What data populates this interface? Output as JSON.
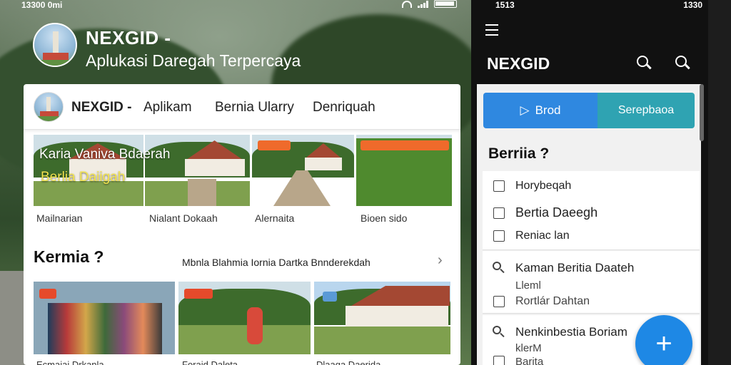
{
  "left_status": {
    "time": "13300 0mi"
  },
  "left_header": {
    "title": "NEXGID -",
    "subtitle": "Aplukasi Daregah Terpercaya"
  },
  "topnav": {
    "brand": "NEXGID -",
    "links": [
      "Aplikam",
      "Bernia Ularry",
      "Denriquah"
    ]
  },
  "featured": {
    "overlay_line1": "Karia Vaniva Bdaerah",
    "overlay_line2": "Berlia Daiigah",
    "captions": [
      "Mailnarian",
      "Nialant Dokaah",
      "Alernaita",
      "Bioen sido"
    ]
  },
  "section": {
    "title": "Kermia ?",
    "subtitle": "Mbnla Blahmia Iornia Dartka Bnnderekdah"
  },
  "bottom_captions": [
    "Ecmaiai Drkanla",
    "Foraid Daleta",
    "Dlaaga Daerida"
  ],
  "right_status": {
    "time": "1513",
    "right": "1330"
  },
  "right_header": {
    "title": "NEXGID"
  },
  "right_tabs": {
    "active": "Brod",
    "other": "Serepbaoa"
  },
  "right_heading": "Berriia ?",
  "right_list": {
    "group1": [
      "Horybeqah",
      "Bertia Daeegh",
      "Reniac lan"
    ],
    "group2": {
      "title": "Kaman Beritia Daateh",
      "line2": "Lleml",
      "line3": "Rortlár Dahtan"
    },
    "group3": {
      "title": "Nenkinbestia Boriam",
      "line2": "klerM",
      "line3": "Barita"
    }
  },
  "fab": {
    "label": "+"
  },
  "colors": {
    "accent_blue": "#2f88e0",
    "accent_teal": "#2fa3b2",
    "fab_blue": "#1e88e5",
    "badge_orange": "#ef6a2b"
  },
  "icons": [
    "wifi-icon",
    "signal-icon",
    "battery-icon",
    "menu-icon",
    "search-icon",
    "play-icon",
    "chevron-right-icon",
    "plus-icon"
  ]
}
